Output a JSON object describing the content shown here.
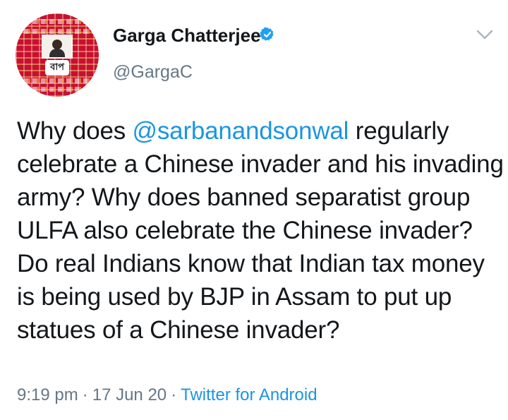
{
  "author": {
    "display_name": "Garga Chatterjee",
    "handle": "@GargaC",
    "verified": true,
    "avatar_logo_text": "বাপ"
  },
  "tweet": {
    "text_before_mention": "Why does ",
    "mention": "@sarbanandsonwal",
    "text_after_mention": " regularly celebrate a Chinese invader and his invading army? Why does banned separatist group ULFA also celebrate the Chinese invader? Do real Indians know that Indian tax money is being used by BJP in Assam to put up statues of a Chinese invader?"
  },
  "meta": {
    "time": "9:19 pm",
    "separator": "·",
    "date": "17 Jun 20",
    "source": "Twitter for Android"
  },
  "icons": {
    "verified": "verified-badge-icon",
    "more": "chevron-down-icon"
  },
  "colors": {
    "link": "#1b95e0",
    "text": "#14171a",
    "secondary": "#657786",
    "verified": "#1da1f2",
    "avatar_bg": "#c8102e"
  }
}
